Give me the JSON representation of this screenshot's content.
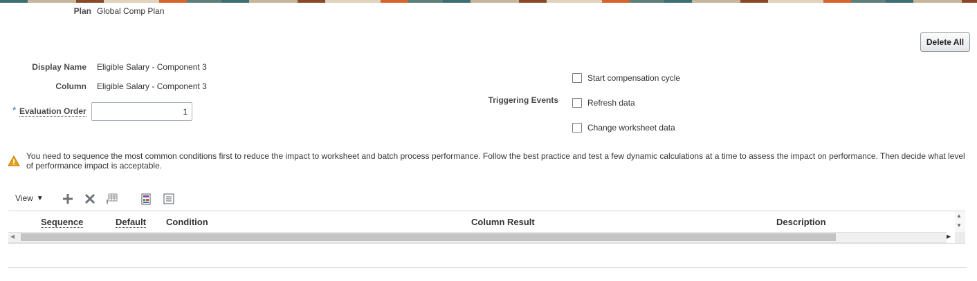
{
  "plan": {
    "label": "Plan",
    "value": "Global Comp Plan"
  },
  "toolbar": {
    "delete_all_label": "Delete All"
  },
  "form": {
    "display_name": {
      "label": "Display Name",
      "value": "Eligible Salary - Component 3"
    },
    "column": {
      "label": "Column",
      "value": "Eligible Salary - Component 3"
    },
    "evaluation_order": {
      "required_mark": "*",
      "label": "Evaluation Order",
      "value": "1"
    }
  },
  "triggering_events": {
    "label": "Triggering Events",
    "options": [
      {
        "label": "Start compensation cycle",
        "checked": false
      },
      {
        "label": "Refresh data",
        "checked": false
      },
      {
        "label": "Change worksheet data",
        "checked": false
      }
    ]
  },
  "warning": {
    "line1": "You need to sequence the most common conditions first to reduce the impact to worksheet and batch process performance. Follow the best practice and test a few dynamic calculations at a time to assess the impact on performance. Then decide what level",
    "line2": "of performance impact is acceptable."
  },
  "table_toolbar": {
    "view_label": "View",
    "icons": [
      "add-icon",
      "delete-icon",
      "freeze-icon",
      "detach-icon",
      "wrap-icon"
    ]
  },
  "table": {
    "columns": [
      "Sequence",
      "Default",
      "Condition",
      "Column Result",
      "Description"
    ]
  },
  "colors": {
    "warning_icon": "#e8a317",
    "required_star": "#1f73b7",
    "scroll_thumb": "#c4c4c4"
  }
}
